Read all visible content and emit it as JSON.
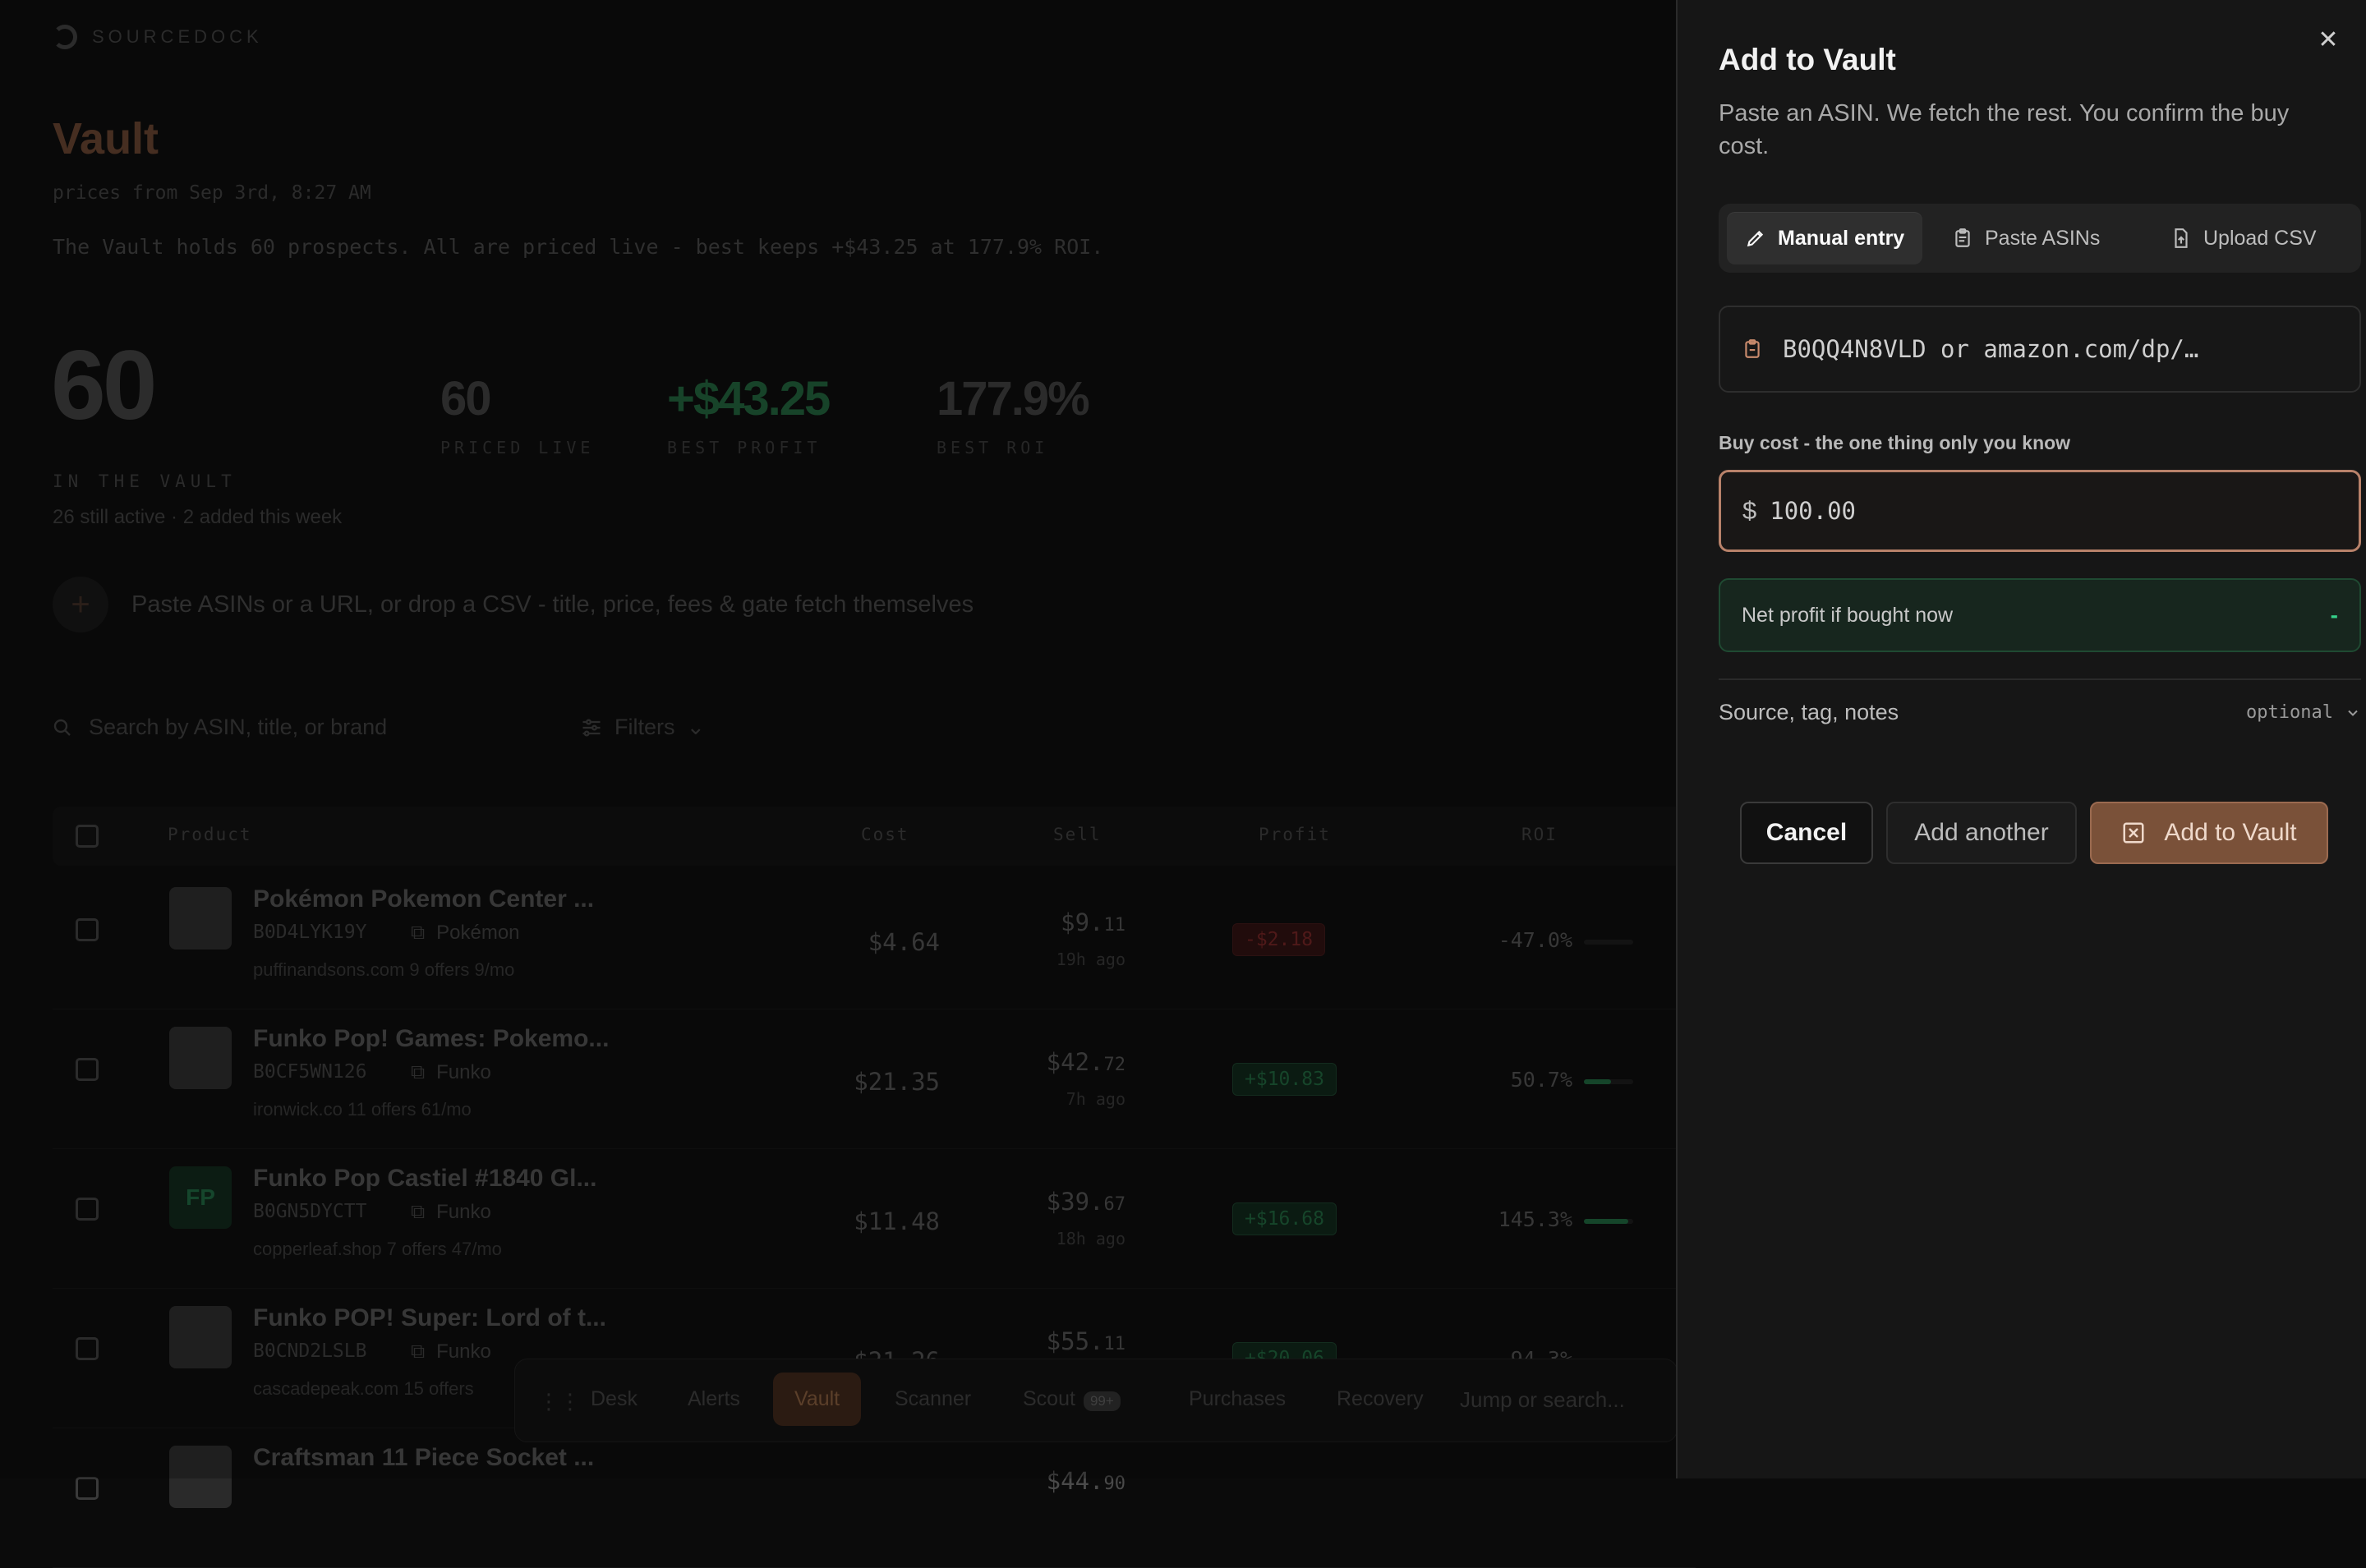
{
  "background": {
    "brand": "SOURCEDOCK",
    "title": "Vault",
    "subtitle": "prices from Sep 3rd, 8:27 AM",
    "description": "The Vault holds 60 prospects. All are priced live - best keeps +$43.25 at 177.9% ROI.",
    "stats": {
      "in_vault": {
        "value": "60",
        "label": "IN THE VAULT",
        "note": "26 still active · 2 added this week"
      },
      "priced_live": {
        "value": "60",
        "label": "PRICED LIVE"
      },
      "best_profit": {
        "value": "+$43.25",
        "label": "BEST PROFIT"
      },
      "best_roi": {
        "value": "177.9%",
        "label": "BEST ROI"
      }
    },
    "paste_hint": "Paste ASINs or a URL, or drop a CSV - title, price, fees & gate fetch themselves",
    "search_placeholder": "Search by ASIN, title, or brand",
    "filters_label": "Filters",
    "table": {
      "headers": {
        "product": "Product",
        "cost": "Cost",
        "sell": "Sell",
        "profit": "Profit",
        "roi": "ROI"
      },
      "rows": [
        {
          "title": "Pokémon Pokemon Center ...",
          "asin": "B0D4LYK19Y",
          "brand": "Pokémon",
          "meta": "puffinandsons.com   9 offers   9/mo",
          "cost": "$4.64",
          "sell_main": "$9.",
          "sell_cents": "11",
          "ago": "19h ago",
          "profit": "-$2.18",
          "roi": "-47.0%",
          "roi_fill": 0,
          "thumb": ""
        },
        {
          "title": "Funko Pop! Games: Pokemo...",
          "asin": "B0CF5WN126",
          "brand": "Funko",
          "meta": "ironwick.co   11 offers   61/mo",
          "cost": "$21.35",
          "sell_main": "$42.",
          "sell_cents": "72",
          "ago": "7h ago",
          "profit": "+$10.83",
          "roi": "50.7%",
          "roi_fill": 0.55,
          "thumb": ""
        },
        {
          "title": "Funko Pop Castiel #1840 Gl...",
          "asin": "B0GN5DYCTT",
          "brand": "Funko",
          "meta": "copperleaf.shop   7 offers   47/mo",
          "cost": "$11.48",
          "sell_main": "$39.",
          "sell_cents": "67",
          "ago": "18h ago",
          "profit": "+$16.68",
          "roi": "145.3%",
          "roi_fill": 0.9,
          "thumb": "FP"
        },
        {
          "title": "Funko POP! Super: Lord of t...",
          "asin": "B0CND2LSLB",
          "brand": "Funko",
          "meta": "cascadepeak.com   15 offers",
          "cost": "$21.26",
          "sell_main": "$55.",
          "sell_cents": "11",
          "ago": "",
          "profit": "+$20.06",
          "roi": "94.3%",
          "roi_fill": 0.7,
          "thumb": ""
        },
        {
          "title": "Craftsman 11 Piece Socket ...",
          "asin": "",
          "brand": "",
          "meta": "",
          "cost": "",
          "sell_main": "$44.",
          "sell_cents": "90",
          "ago": "",
          "profit": "",
          "roi": "",
          "roi_fill": 0,
          "thumb": ""
        }
      ]
    },
    "dock": {
      "items": [
        "Desk",
        "Alerts",
        "Vault",
        "Scanner",
        "Scout",
        "Purchases",
        "Recovery"
      ],
      "scout_badge": "99+",
      "search": "Jump or search..."
    }
  },
  "drawer": {
    "title": "Add to Vault",
    "subtitle": "Paste an ASIN. We fetch the rest. You confirm the buy cost.",
    "tabs": [
      "Manual entry",
      "Paste ASINs",
      "Upload CSV"
    ],
    "asin_placeholder": "B0QQ4N8VLD or amazon.com/dp/…",
    "cost_label": "Buy cost - the one thing only you know",
    "currency": "$",
    "cost_value": "100.00",
    "net_label": "Net profit if bought now",
    "net_value": "-",
    "options_label": "Source, tag, notes",
    "options_hint": "optional",
    "buttons": {
      "cancel": "Cancel",
      "add_another": "Add another",
      "add": "Add to Vault"
    },
    "colors": {
      "accent": "#b8826a",
      "positive": "#36d08a"
    }
  }
}
